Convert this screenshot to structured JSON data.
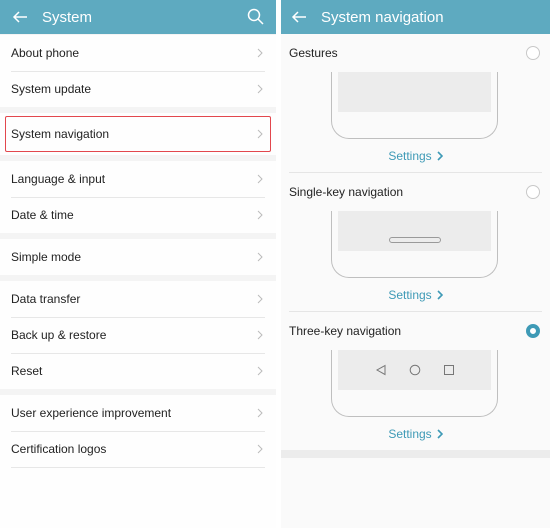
{
  "left": {
    "title": "System",
    "icons": {
      "back": "arrow-left-icon",
      "search": "search-icon"
    },
    "groups": [
      {
        "items": [
          {
            "label": "About phone"
          },
          {
            "label": "System update"
          }
        ]
      },
      {
        "items": [
          {
            "label": "System navigation",
            "highlighted": true
          }
        ]
      },
      {
        "items": [
          {
            "label": "Language & input"
          },
          {
            "label": "Date & time"
          }
        ]
      },
      {
        "items": [
          {
            "label": "Simple mode"
          }
        ]
      },
      {
        "items": [
          {
            "label": "Data transfer"
          },
          {
            "label": "Back up & restore"
          },
          {
            "label": "Reset"
          }
        ]
      },
      {
        "items": [
          {
            "label": "User experience improvement"
          },
          {
            "label": "Certification logos"
          }
        ]
      }
    ],
    "highlight_color": "#e2474d"
  },
  "right": {
    "title": "System navigation",
    "icons": {
      "back": "arrow-left-icon"
    },
    "options": [
      {
        "label": "Gestures",
        "selected": false,
        "preview": "gestures",
        "settings_label": "Settings"
      },
      {
        "label": "Single-key navigation",
        "selected": false,
        "preview": "single-key",
        "settings_label": "Settings"
      },
      {
        "label": "Three-key navigation",
        "selected": true,
        "preview": "three-key",
        "settings_label": "Settings"
      }
    ]
  },
  "colors": {
    "appbar": "#5eaac0",
    "accent": "#3e9ab6"
  }
}
